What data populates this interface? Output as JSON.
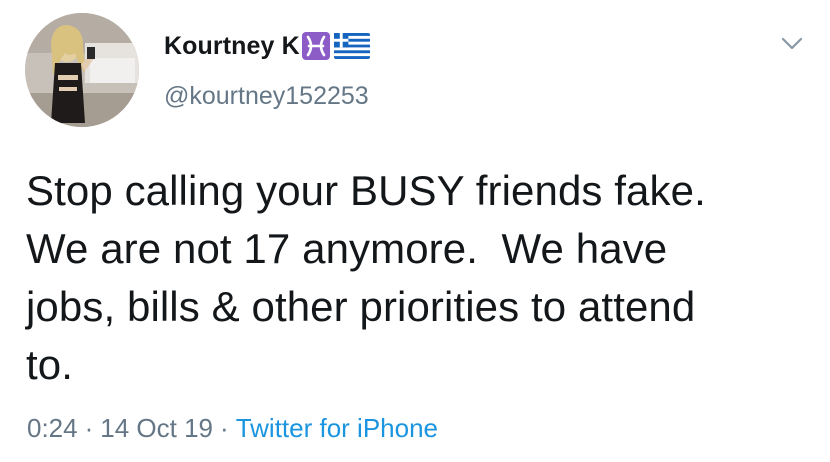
{
  "tweet": {
    "author": {
      "display_name": "Kourtney K",
      "handle": "@kourtney152253",
      "badges": [
        "pisces-emoji-icon",
        "greece-flag-icon"
      ]
    },
    "text": "Stop calling your BUSY friends fake.\nWe are not 17 anymore.  We have\njobs, bills & other priorities to attend\nto.",
    "time": "0:24",
    "separator": "·",
    "date": "14 Oct 19",
    "source": "Twitter for iPhone"
  },
  "colors": {
    "text": "#14171a",
    "secondary": "#657786",
    "link": "#1b95e0",
    "pisces_badge": "#8c5cc7"
  }
}
